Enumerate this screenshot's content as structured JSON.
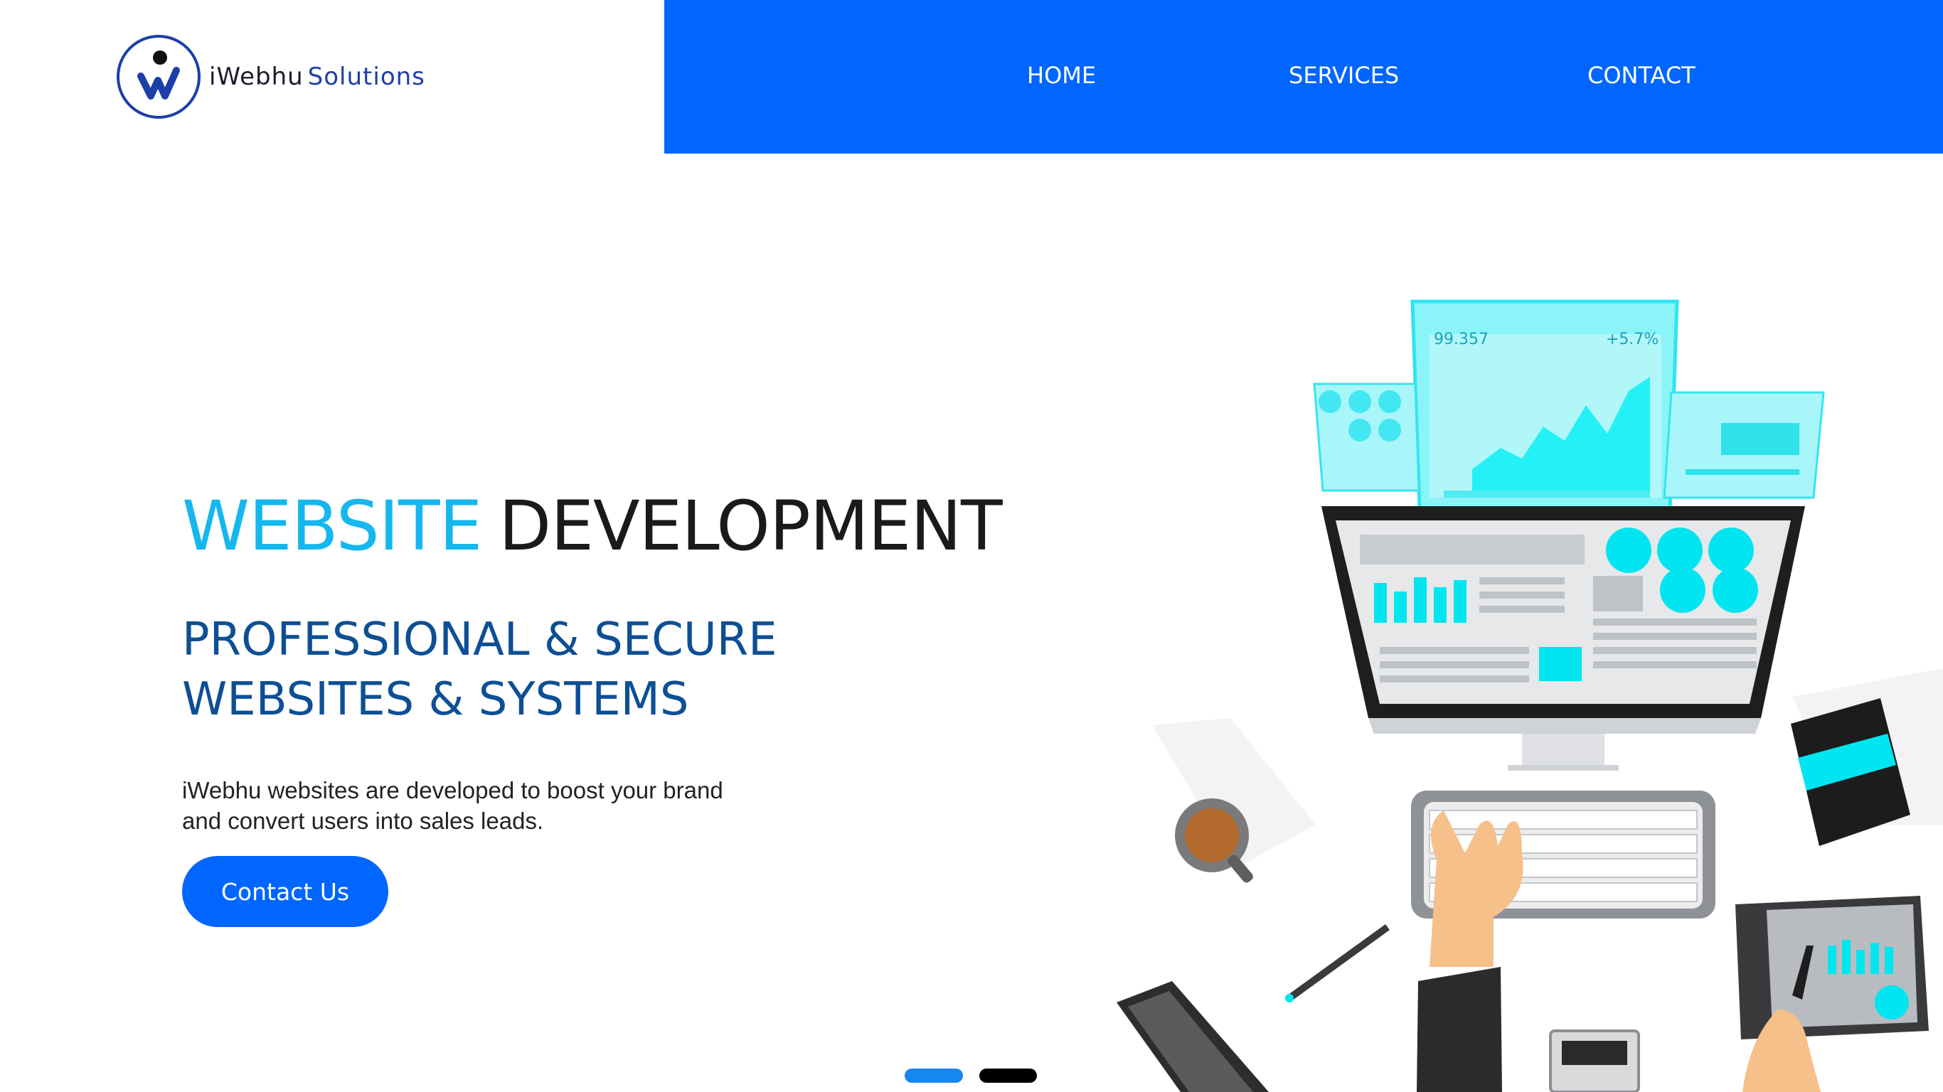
{
  "brand": {
    "name_part1": "iWebhu",
    "name_part2": "Solutions"
  },
  "nav": {
    "items": [
      {
        "label": "HOME"
      },
      {
        "label": "SERVICES"
      },
      {
        "label": "CONTACT"
      }
    ]
  },
  "hero": {
    "title_highlight": "WEBSITE",
    "title_rest": "DEVELOPMENT",
    "subtitle_line1": "PROFESSIONAL & SECURE",
    "subtitle_line2": "WEBSITES & SYSTEMS",
    "description_line1": "iWebhu websites are developed to boost your brand",
    "description_line2": "and convert users into sales leads.",
    "cta_label": "Contact Us"
  },
  "slider": {
    "slide_count": 2,
    "active_index": 0
  },
  "illustration": {
    "screen_value": "99.357",
    "screen_change": "+5.7%"
  },
  "colors": {
    "nav_background": "#0066ff",
    "title_highlight": "#16b7ee",
    "subtitle": "#0d4f94",
    "cta_background": "#0066ff",
    "dot_active": "#1787f0",
    "dot_inactive": "#000000",
    "accent_cyan": "#00e5f0"
  },
  "icons": {
    "logo": "iwebhu-logo-icon"
  }
}
